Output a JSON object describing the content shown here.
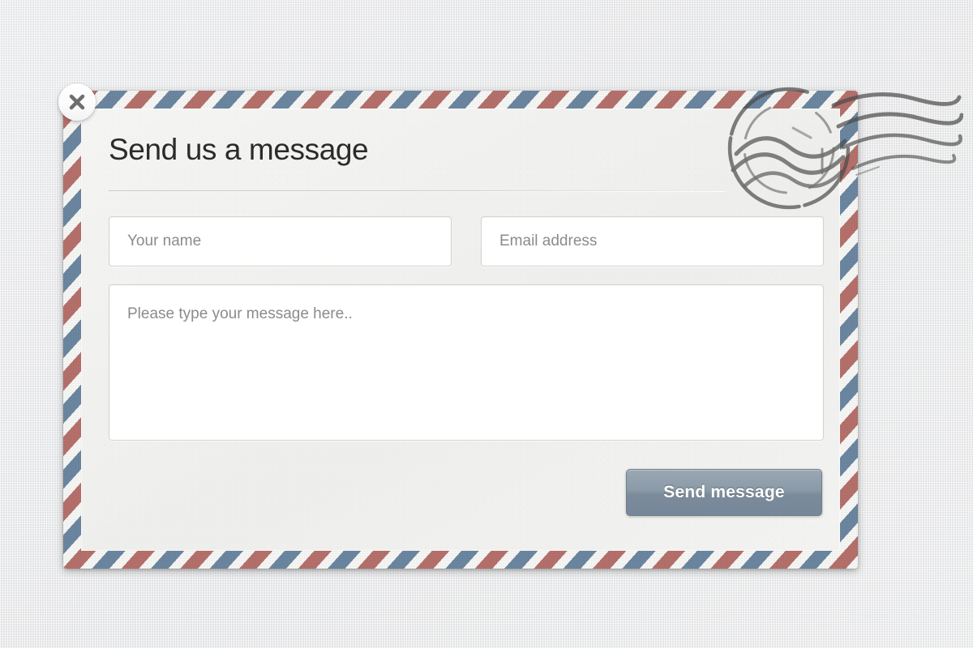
{
  "window": {
    "background_color": "#e9eaeb"
  },
  "close_button": {
    "icon": "close-x-icon",
    "label": "Close"
  },
  "card": {
    "title": "Send us a message",
    "border_style": "airmail-diagonal-stripes",
    "stripe_color_red": "#b5706b",
    "stripe_color_blue": "#6b86a0",
    "paper_color": "#f1f1ef"
  },
  "postmark": {
    "icon": "postmark-stamp-icon",
    "description": "circular postmark with wavy cancellation lines",
    "ink_color": "#4a4a4a"
  },
  "form": {
    "name_field": {
      "placeholder": "Your name",
      "value": ""
    },
    "email_field": {
      "placeholder": "Email address",
      "value": ""
    },
    "message_field": {
      "placeholder": "Please type your message here..",
      "value": ""
    },
    "submit_button": {
      "label": "Send message",
      "color": "#85949f"
    }
  }
}
